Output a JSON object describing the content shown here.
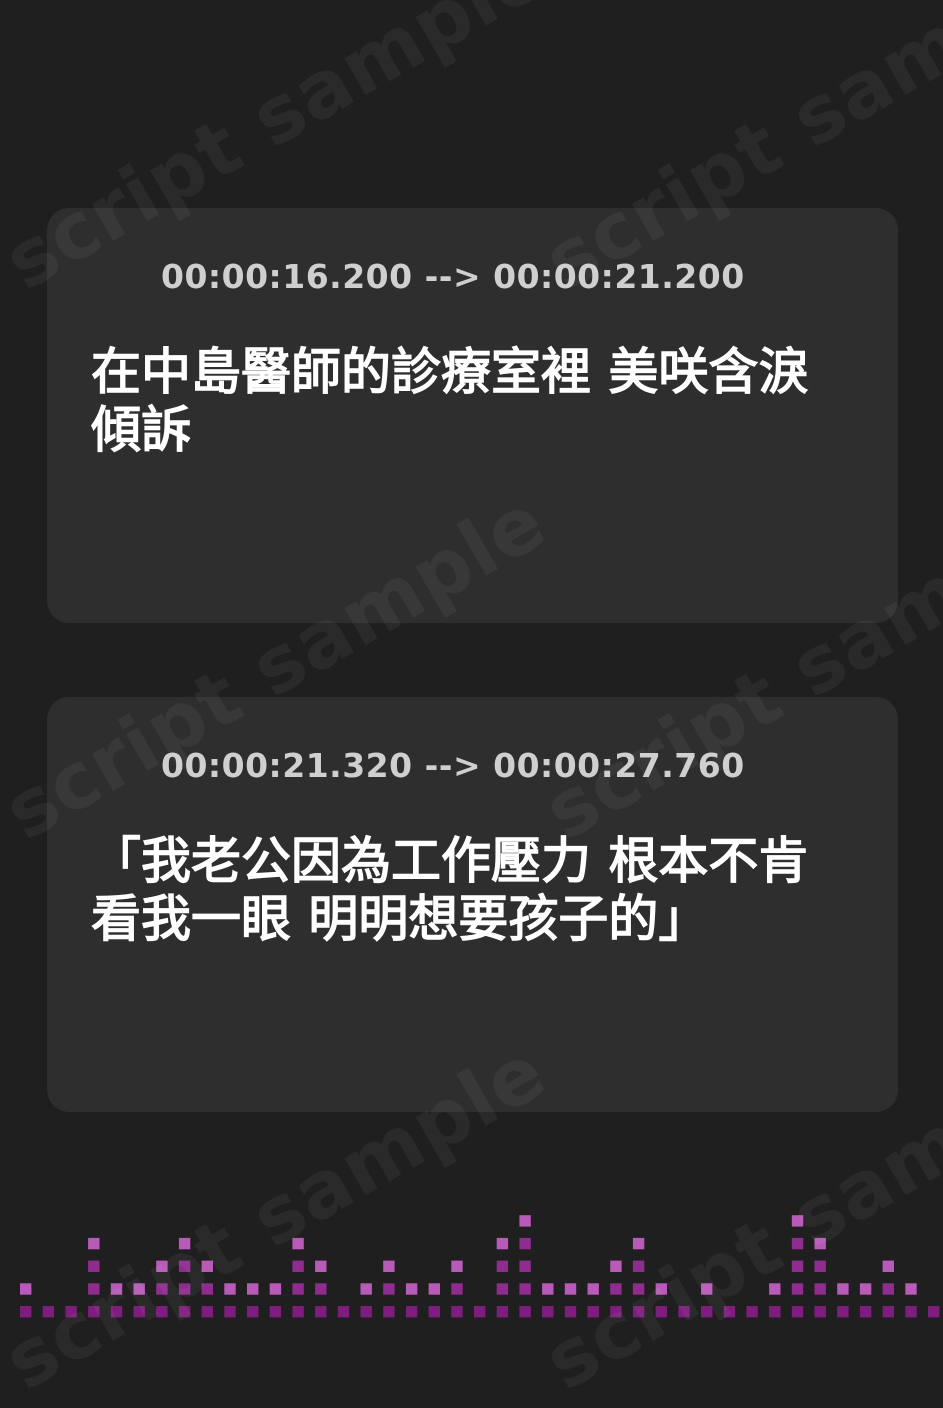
{
  "watermark": "script sample",
  "accent_color": "#cc44cc",
  "icon": "sound-wave-icon",
  "subtitles": [
    {
      "timestamp": "00:00:16.200 --> 00:00:21.200",
      "text": "在中島醫師的診療室裡 美咲含淚傾訴"
    },
    {
      "timestamp": "00:00:21.320 --> 00:00:27.760",
      "text": "「我老公因為工作壓力 根本不肯看我一眼 明明想要孩子的」"
    }
  ]
}
